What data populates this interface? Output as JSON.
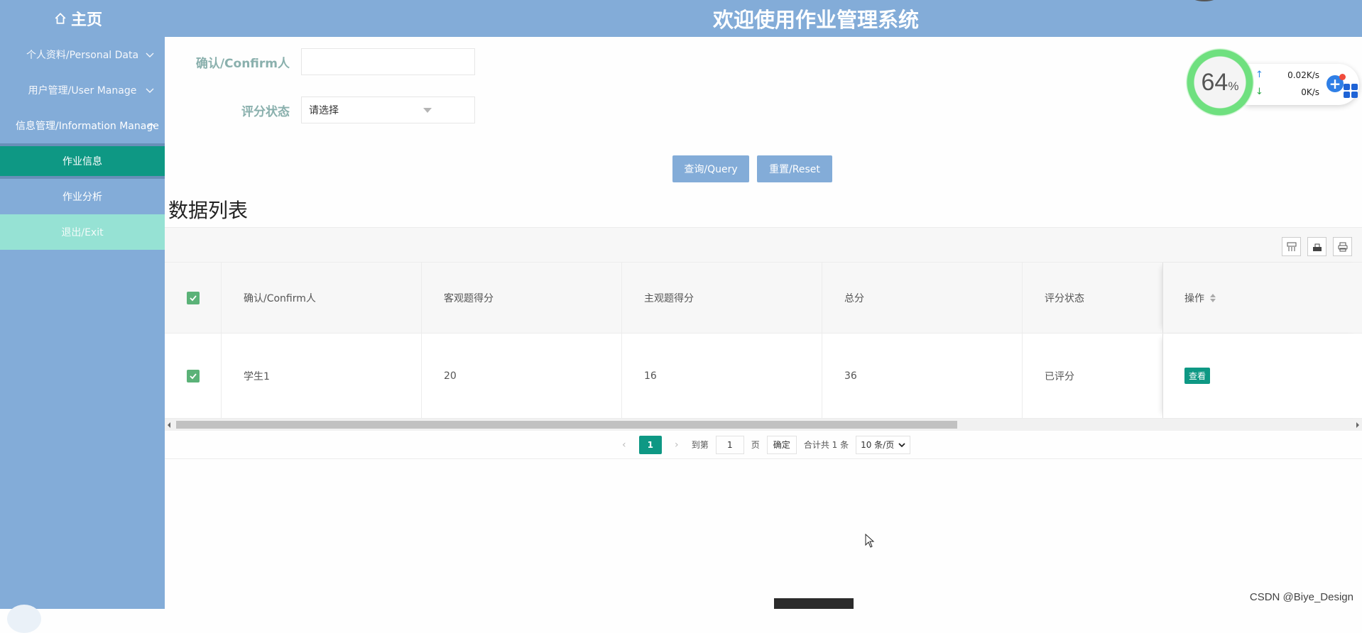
{
  "header": {
    "home_label": "主页",
    "title": "欢迎使用作业管理系统"
  },
  "sidebar": {
    "items": [
      {
        "label": "个人资料/Personal Data"
      },
      {
        "label": "用户管理/User Manage"
      },
      {
        "label": "信息管理/Information Manage"
      }
    ],
    "submenu": [
      {
        "label": "作业信息"
      },
      {
        "label": "作业分析"
      }
    ],
    "exit": "退出/Exit"
  },
  "search": {
    "confirm_label": "确认/Confirm人",
    "confirm_value": "",
    "status_label": "评分状态",
    "status_placeholder": "请选择",
    "query_button": "查询/Query",
    "reset_button": "重置/Reset"
  },
  "list_title": "数据列表",
  "table": {
    "headers": [
      "确认/Confirm人",
      "客观题得分",
      "主观题得分",
      "总分",
      "评分状态",
      "操作"
    ],
    "rows": [
      {
        "confirm": "学生1",
        "objective": "20",
        "subjective": "16",
        "total": "36",
        "status": "已评分",
        "action": "查看"
      }
    ]
  },
  "pagination": {
    "current": "1",
    "goto_label": "到第",
    "goto_value": "1",
    "page_unit": "页",
    "confirm": "确定",
    "total": "合计共 1 条",
    "page_size": "10 条/页"
  },
  "network": {
    "percent": "64",
    "percent_sign": "%",
    "upload": "0.02K/s",
    "download": "0K/s"
  },
  "watermark": "CSDN @Biye_Design",
  "colors": {
    "primary": "#83acd8",
    "accent": "#0e9884",
    "exit": "#96e2d4"
  }
}
